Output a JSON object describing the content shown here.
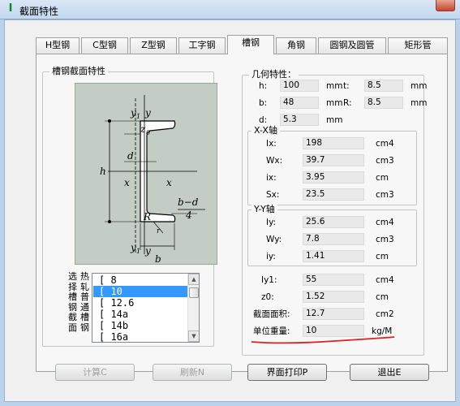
{
  "window": {
    "title": "截面特性",
    "icon": "steel-app-icon"
  },
  "tabs": [
    {
      "label": "H型钢"
    },
    {
      "label": "C型钢"
    },
    {
      "label": "Z型钢"
    },
    {
      "label": "工字钢"
    },
    {
      "label": "槽钢"
    },
    {
      "label": "角钢"
    },
    {
      "label": "圆钢及圆管"
    },
    {
      "label": "矩形管"
    }
  ],
  "active_tab": "槽钢",
  "section_group": {
    "title": "槽钢截面特性"
  },
  "diagram_labels": {
    "y_top": "y",
    "y1_top": "y",
    "y1_sub_top": "1",
    "z0": "z",
    "z0_sub": "0",
    "d": "d",
    "x_left": "x",
    "x_right": "x",
    "h": "h",
    "r": "R",
    "r1": "r",
    "b_minus_d": "b−d",
    "four": "4",
    "y_bottom": "y",
    "y1_bottom": "y",
    "y1_sub_bottom": "1",
    "b": "b"
  },
  "hint_labels": {
    "col1": [
      "选",
      "择",
      "槽",
      "钢",
      "截",
      "面"
    ],
    "col2": [
      "热",
      "轧",
      "普",
      "通",
      "槽",
      "钢"
    ]
  },
  "size_list": {
    "items": [
      "[ 8",
      "[ 10",
      "[ 12.6",
      "[ 14a",
      "[ 14b",
      "[ 16a"
    ],
    "selected": "[ 10"
  },
  "geometry": {
    "title": "几何特性：",
    "h": {
      "label": "h:",
      "value": "100",
      "unit": "mm"
    },
    "t": {
      "label": "t:",
      "value": "8.5",
      "unit": "mm"
    },
    "b": {
      "label": "b:",
      "value": "48",
      "unit": "mm"
    },
    "R": {
      "label": "R:",
      "value": "8.5",
      "unit": "mm"
    },
    "d": {
      "label": "d:",
      "value": "5.3",
      "unit": "mm"
    }
  },
  "xx_axis": {
    "title": "X-X轴",
    "rows": [
      {
        "label": "Ix:",
        "value": "198",
        "unit": "cm4"
      },
      {
        "label": "Wx:",
        "value": "39.7",
        "unit": "cm3"
      },
      {
        "label": "ix:",
        "value": "3.95",
        "unit": "cm"
      },
      {
        "label": "Sx:",
        "value": "23.5",
        "unit": "cm3"
      }
    ]
  },
  "yy_axis": {
    "title": "Y-Y轴",
    "rows": [
      {
        "label": "Iy:",
        "value": "25.6",
        "unit": "cm4"
      },
      {
        "label": "Wy:",
        "value": "7.8",
        "unit": "cm3"
      },
      {
        "label": "iy:",
        "value": "1.41",
        "unit": "cm"
      }
    ]
  },
  "extra": {
    "rows": [
      {
        "label": "Iy1:",
        "value": "55",
        "unit": "cm4"
      },
      {
        "label": "z0:",
        "value": "1.52",
        "unit": "cm"
      },
      {
        "label": "截面面积:",
        "value": "12.7",
        "unit": "cm2"
      },
      {
        "label": "单位重量:",
        "value": "10",
        "unit": "kg/M"
      }
    ]
  },
  "buttons": {
    "calculate": "计算C",
    "refresh": "刷新N",
    "print": "界面打印P",
    "exit": "退出E"
  },
  "colors": {
    "diagram_bg": "#c3cdc5",
    "selection": "#3399ff",
    "annotation": "#e02020"
  }
}
